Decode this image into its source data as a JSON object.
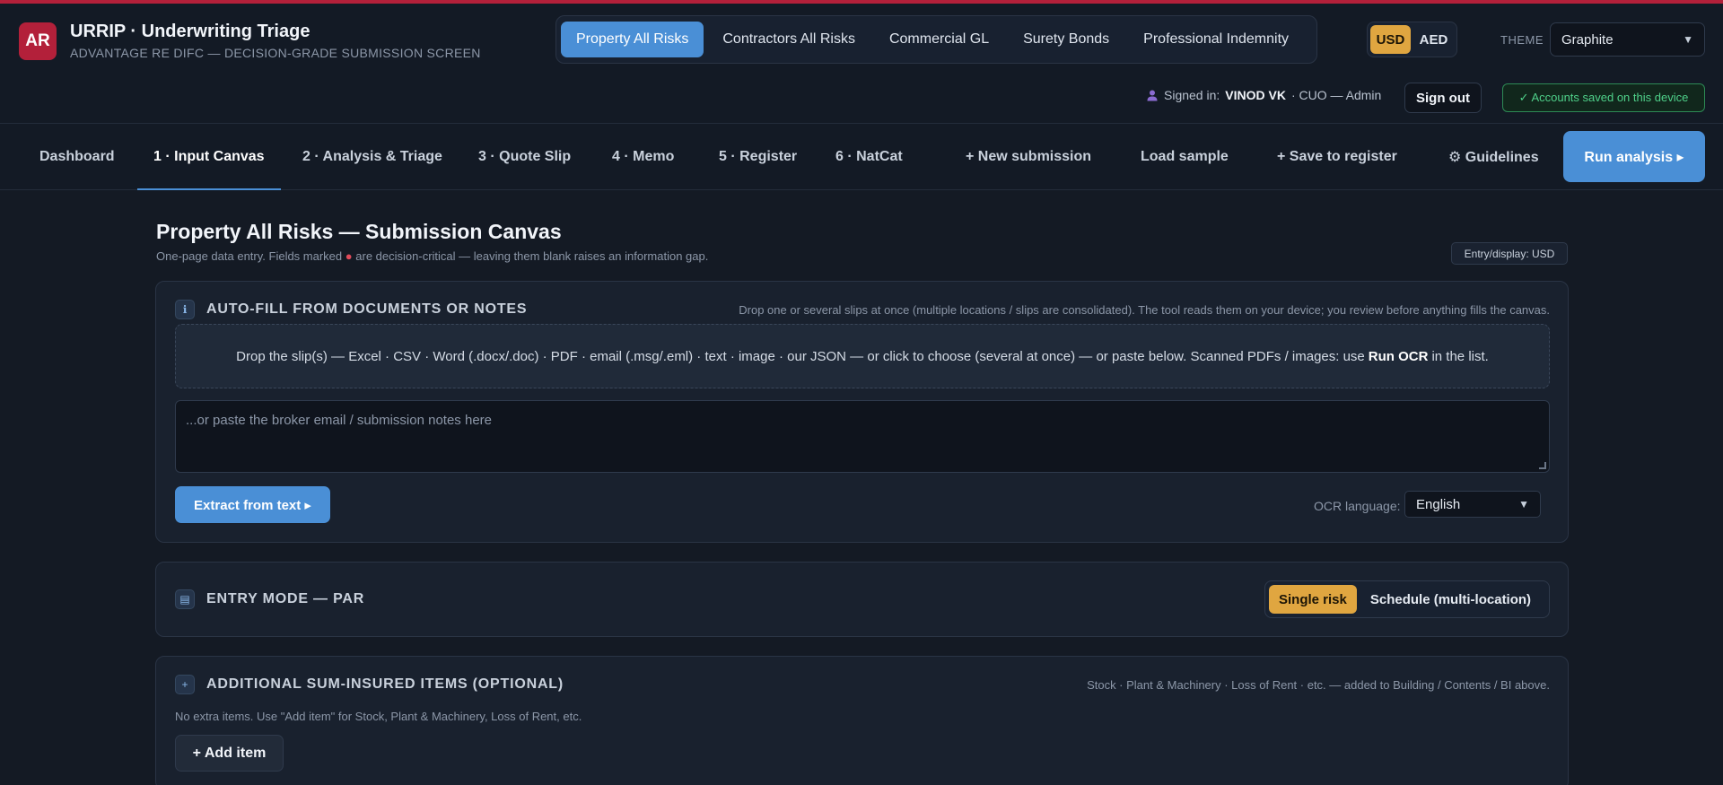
{
  "app": {
    "logo": "AR",
    "title": "URRIP · Underwriting Triage",
    "subtitle": "ADVANTAGE RE DIFC — DECISION-GRADE SUBMISSION SCREEN"
  },
  "lines_of_business": [
    {
      "label": "Property All Risks",
      "active": true
    },
    {
      "label": "Contractors All Risks",
      "active": false
    },
    {
      "label": "Commercial GL",
      "active": false
    },
    {
      "label": "Surety Bonds",
      "active": false
    },
    {
      "label": "Professional Indemnity",
      "active": false
    }
  ],
  "currency": {
    "options": [
      "USD",
      "AED"
    ],
    "selected": "USD"
  },
  "theme": {
    "label": "THEME",
    "value": "Graphite"
  },
  "session": {
    "signed_in_prefix": "Signed in:",
    "user": "VINOD VK",
    "role": "· CUO — Admin",
    "sign_out": "Sign out",
    "saved_badge": "✓ Accounts saved on this device"
  },
  "nav": {
    "items": [
      {
        "label": "Dashboard",
        "active": false
      },
      {
        "label": "1 · Input Canvas",
        "active": true
      },
      {
        "label": "2 · Analysis & Triage",
        "active": false
      },
      {
        "label": "3 · Quote Slip",
        "active": false
      },
      {
        "label": "4 · Memo",
        "active": false
      },
      {
        "label": "5 · Register",
        "active": false
      },
      {
        "label": "6 · NatCat",
        "active": false
      },
      {
        "label": "+ New submission",
        "active": false
      },
      {
        "label": "Load sample",
        "active": false
      },
      {
        "label": "+ Save to register",
        "active": false
      },
      {
        "label": "⚙ Guidelines",
        "active": false
      }
    ],
    "run_label": "Run analysis ▸"
  },
  "page": {
    "title": "Property All Risks — Submission Canvas",
    "sub_before": "One-page data entry. Fields marked",
    "sub_dot": "●",
    "sub_after": "are decision-critical — leaving them blank raises an information gap.",
    "entry_badge": "Entry/display: USD"
  },
  "autofill": {
    "icon": "info-icon",
    "title": "AUTO-FILL FROM DOCUMENTS OR NOTES",
    "note": "Drop one or several slips at once (multiple locations / slips are consolidated). The tool reads them on your device; you review before anything fills the canvas.",
    "drop_text_before": "Drop the slip(s) — Excel · CSV · Word (.docx/.doc) · PDF · email (.msg/.eml) · text · image · our JSON — or click to choose (several at once) — or paste below. Scanned PDFs / images: use",
    "drop_text_bold": "Run OCR",
    "drop_text_after": "in the list.",
    "notes_placeholder": "...or paste the broker email / submission notes here",
    "extract_label": "Extract from text ▸",
    "ocr_label": "OCR language:",
    "ocr_value": "English"
  },
  "entry_mode": {
    "icon": "form-icon",
    "title": "ENTRY MODE — PAR",
    "options": [
      "Single risk",
      "Schedule (multi-location)"
    ],
    "selected": "Single risk"
  },
  "additional": {
    "icon": "plus-icon",
    "title": "ADDITIONAL SUM-INSURED ITEMS (OPTIONAL)",
    "note": "Stock · Plant & Machinery · Loss of Rent · etc. — added to Building / Contents / BI above.",
    "empty_text": "No extra items. Use \"Add item\" for Stock, Plant & Machinery, Loss of Rent, etc.",
    "add_label": "+ Add item"
  },
  "colors": {
    "accent_blue": "#4a8fd6",
    "accent_gold": "#e0a640",
    "brand_red": "#b3203a",
    "success_green": "#4fd18a"
  }
}
